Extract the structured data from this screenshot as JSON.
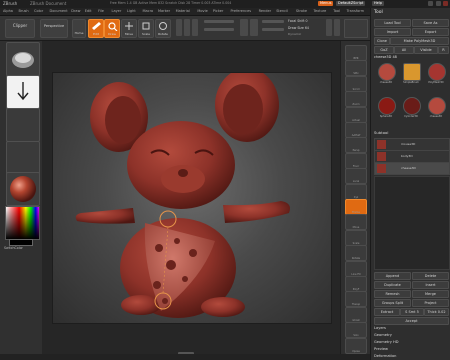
{
  "titlebar": {
    "app": "ZBrush",
    "project": "ZBrush Document",
    "stats": "Free Mem 1.4 GB  Active Mem 832  Scratch Disk 28  Timer 0.003  ATime 0.004",
    "menus_btn": "Menus",
    "default_script": "DefaultZScript",
    "help": "Help"
  },
  "menubar": [
    "Alpha",
    "Brush",
    "Color",
    "Document",
    "Draw",
    "Edit",
    "File",
    "Layer",
    "Light",
    "Macro",
    "Marker",
    "Material",
    "Movie",
    "Picker",
    "Preferences",
    "Render",
    "Stencil",
    "Stroke",
    "Texture",
    "Tool",
    "Transform",
    "Zplugin",
    "Zscript"
  ],
  "toolbar": {
    "clipper": "Clipper",
    "perspective": "Perspective",
    "home": "Home",
    "edit": "Edit",
    "draw": "Draw",
    "move": "Move",
    "scale": "Scale",
    "rotate": "Rotate",
    "total_points": "Total Points: 0",
    "focal_shift": "Focal Shift 0",
    "draw_size": "Draw Size 64",
    "dynamic": "Dynamic"
  },
  "leftpanel": {
    "color_label": "SwitchColor"
  },
  "iconstrip": [
    "BPR",
    "SPix",
    "Scroll",
    "Zoom",
    "Actual",
    "AAHalf",
    "Persp",
    "Floor",
    "Local",
    "Xyz",
    "Frame",
    "Move",
    "Scale",
    "Rotate",
    "Line Fill",
    "PolyF",
    "Transp",
    "Ghost",
    "Solo",
    "Xpose"
  ],
  "rightpanel": {
    "title": "Tool",
    "load_tool": "Load Tool",
    "save_as": "Save As",
    "import": "Import",
    "export": "Export",
    "clone": "Clone",
    "make_polymesh": "Make PolyMesh3D",
    "goz": "GoZ",
    "all": "All",
    "visible": "Visible",
    "r": "R",
    "current_tool": "cheese3D 48",
    "tools": [
      {
        "name": "cheese3D",
        "color": "#b54a3e"
      },
      {
        "name": "SimpleBrush",
        "color": "#d9972e"
      },
      {
        "name": "PolyMesh3D",
        "color": "#a53530"
      },
      {
        "name": "Sphere3D",
        "color": "#8a1a14"
      },
      {
        "name": "Cylinder3D",
        "color": "#6a1c18"
      },
      {
        "name": "cheese3D",
        "color": "#b54a3e"
      }
    ],
    "subtool_section": "Subtool",
    "subtools": [
      "mouse3D",
      "body3D",
      "cheese3D"
    ],
    "buttons": {
      "append": "Append",
      "delete": "Delete",
      "duplicate": "Duplicate",
      "insert": "Insert",
      "groups_split": "Groups Split",
      "merge": "Merge",
      "remesh": "Remesh",
      "project": "Project",
      "extract": "Extract",
      "thick": "Thick 0.02",
      "s_smt": "S Smt 5",
      "accept": "Accept"
    },
    "sections": [
      "Layers",
      "Geometry",
      "Geometry HD",
      "Preview",
      "Deformation"
    ]
  },
  "colors": {
    "accent": "#e06a12",
    "model": "#8d3229",
    "model_light": "#b24a3c",
    "model_dark": "#5a1c16"
  }
}
